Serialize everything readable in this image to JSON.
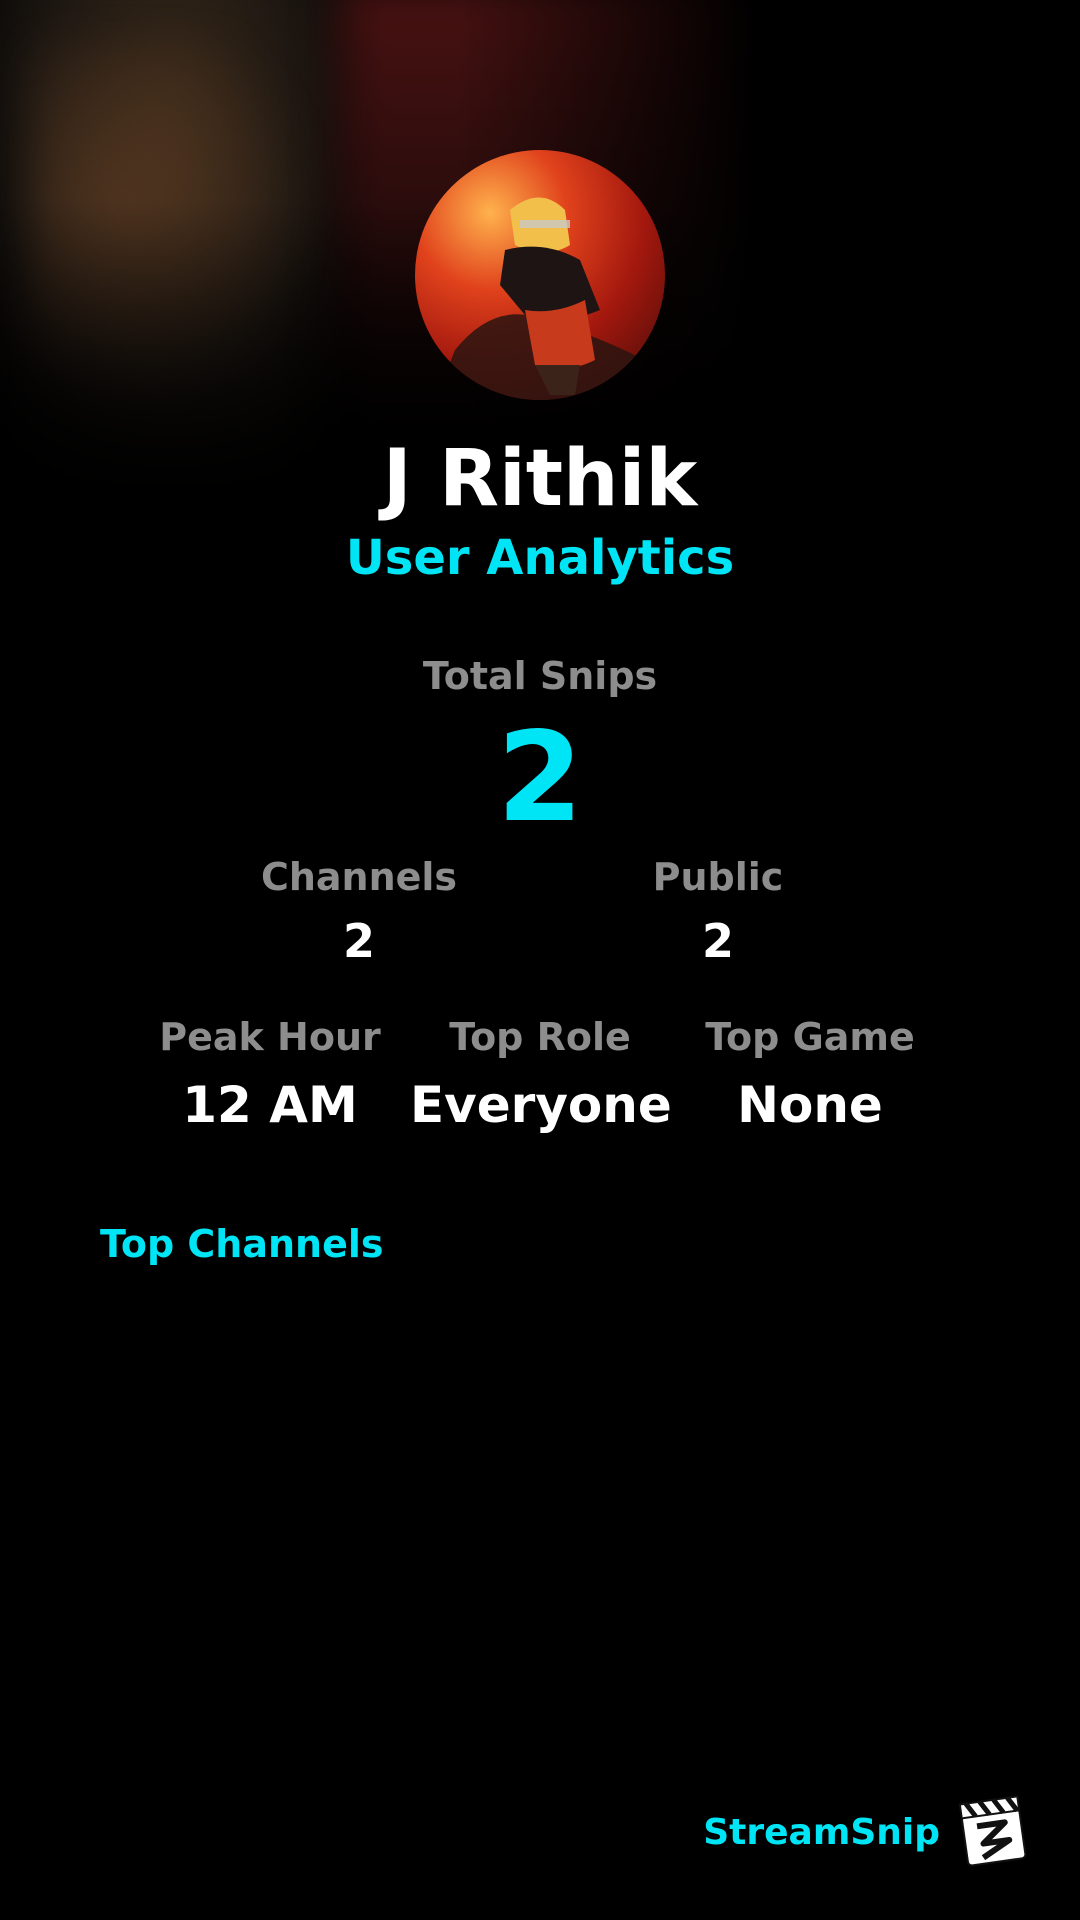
{
  "profile": {
    "username": "J Rithik",
    "subtitle": "User Analytics"
  },
  "stats": {
    "total_snips_label": "Total Snips",
    "total_snips_value": "2",
    "channels_label": "Channels",
    "channels_value": "2",
    "public_label": "Public",
    "public_value": "2",
    "peak_hour_label": "Peak Hour",
    "peak_hour_value": "12 AM",
    "top_role_label": "Top Role",
    "top_role_value": "Everyone",
    "top_game_label": "Top Game",
    "top_game_value": "None"
  },
  "sections": {
    "top_channels_title": "Top Channels"
  },
  "brand": {
    "name": "StreamSnip"
  },
  "colors": {
    "accent": "#00e5f5",
    "background": "#000000",
    "muted_label": "#8d8d8d"
  }
}
